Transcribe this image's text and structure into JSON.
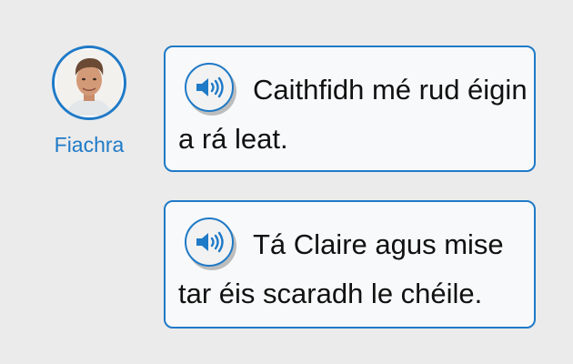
{
  "speaker": {
    "name": "Fiachra"
  },
  "messages": [
    {
      "text": "Caithfidh mé rud éigin a rá leat.",
      "audio_icon": "speaker-icon"
    },
    {
      "text": "Tá Claire agus mise tar éis scaradh le chéile.",
      "audio_icon": "speaker-icon"
    }
  ],
  "colors": {
    "accent": "#1f7ac7",
    "background": "#ebebeb",
    "bubble": "#f8f9fa",
    "text": "#111111"
  }
}
